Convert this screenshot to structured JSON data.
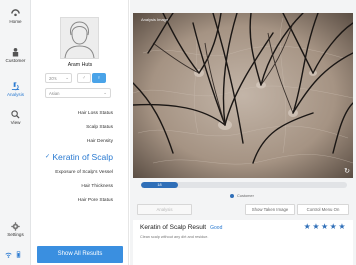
{
  "nav": {
    "items": [
      {
        "label": "Home",
        "icon": "home-icon"
      },
      {
        "label": "Customer",
        "icon": "customer-icon"
      },
      {
        "label": "Analysis",
        "icon": "analysis-icon"
      },
      {
        "label": "View",
        "icon": "view-icon"
      }
    ],
    "settings_label": "Settings",
    "accent": "#2a7ad1"
  },
  "customer": {
    "name": "Aram Huts",
    "age": "20's",
    "ethnicity": "Asian"
  },
  "menu": {
    "items": [
      {
        "label": "Hair Loss Status",
        "active": false
      },
      {
        "label": "Scalp Status",
        "active": false
      },
      {
        "label": "Hair Density",
        "active": false
      },
      {
        "label": "Keratin of Scalp",
        "active": true
      },
      {
        "label": "Exposure of Scalp's Vessel",
        "active": false
      },
      {
        "label": "Hair Thickness",
        "active": false
      },
      {
        "label": "Hair Pore Status",
        "active": false
      }
    ],
    "show_all_label": "Show All Results"
  },
  "image": {
    "label": "Analysis Image"
  },
  "progress": {
    "value": 18,
    "value_label": "18",
    "legend": "Customer"
  },
  "buttons": {
    "analysis": "Analysis",
    "show_taken": "Show Taken Image",
    "control_menu": "Control Menu On"
  },
  "result": {
    "title": "Keratin of Scalp Result",
    "grade": "Good",
    "description": "Clean scalp without any dirt and residue.",
    "stars": 5
  }
}
